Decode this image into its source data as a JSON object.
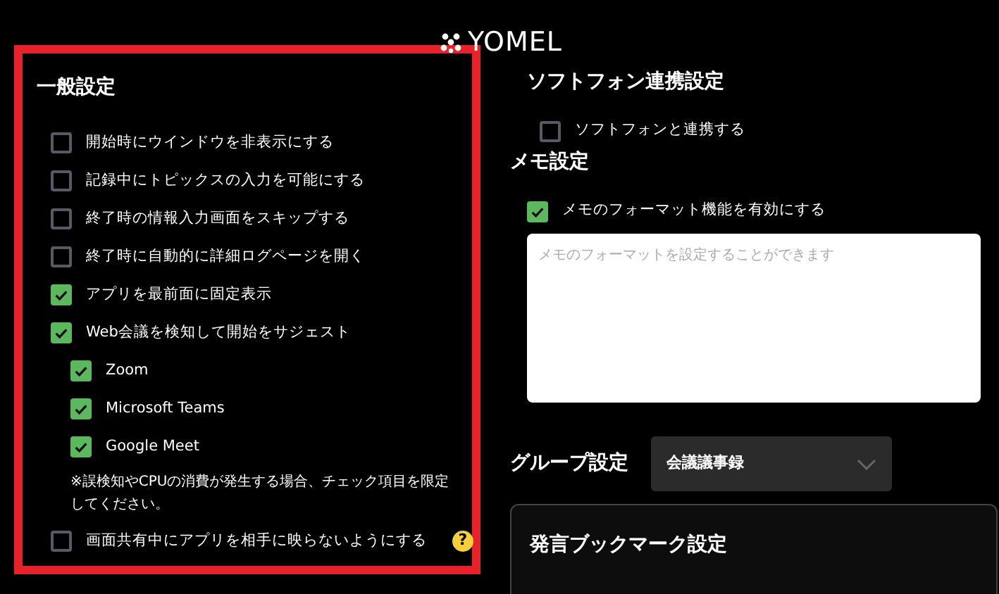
{
  "logo": {
    "text": "YOMEL"
  },
  "general_settings": {
    "title": "一般設定",
    "items": [
      {
        "kind": "checkbox",
        "label": "開始時にウインドウを非表示にする",
        "checked": false
      },
      {
        "kind": "checkbox",
        "label": "記録中にトピックスの入力を可能にする",
        "checked": false
      },
      {
        "kind": "checkbox",
        "label": "終了時の情報入力画面をスキップする",
        "checked": false
      },
      {
        "kind": "checkbox",
        "label": "終了時に自動的に詳細ログページを開く",
        "checked": false
      },
      {
        "kind": "checkbox",
        "label": "アプリを最前面に固定表示",
        "checked": true
      },
      {
        "kind": "checkbox",
        "label": "Web会議を検知して開始をサジェスト",
        "checked": true,
        "children": [
          {
            "kind": "checkbox",
            "label": "Zoom",
            "checked": true
          },
          {
            "kind": "checkbox",
            "label": "Microsoft Teams",
            "checked": true
          },
          {
            "kind": "checkbox",
            "label": "Google Meet",
            "checked": true
          },
          {
            "kind": "note",
            "text": "※誤検知やCPUの消費が発生する場合、チェック項目を限定してください。"
          }
        ]
      },
      {
        "kind": "checkbox",
        "label": "画面共有中にアプリを相手に映らないようにする",
        "checked": false,
        "help": "?"
      }
    ]
  },
  "softphone_settings": {
    "title": "ソフトフォン連携設定",
    "option": {
      "label": "ソフトフォンと連携する",
      "checked": false
    }
  },
  "memo_settings": {
    "title": "メモ設定",
    "option": {
      "label": "メモのフォーマット機能を有効にする",
      "checked": true
    },
    "format_field": {
      "placeholder": "メモのフォーマットを設定することができます"
    }
  },
  "group_settings": {
    "title": "グループ設定",
    "dropdown": {
      "value": "会議議事録"
    }
  },
  "bookmark_settings": {
    "title": "発言ブックマーク設定"
  }
}
